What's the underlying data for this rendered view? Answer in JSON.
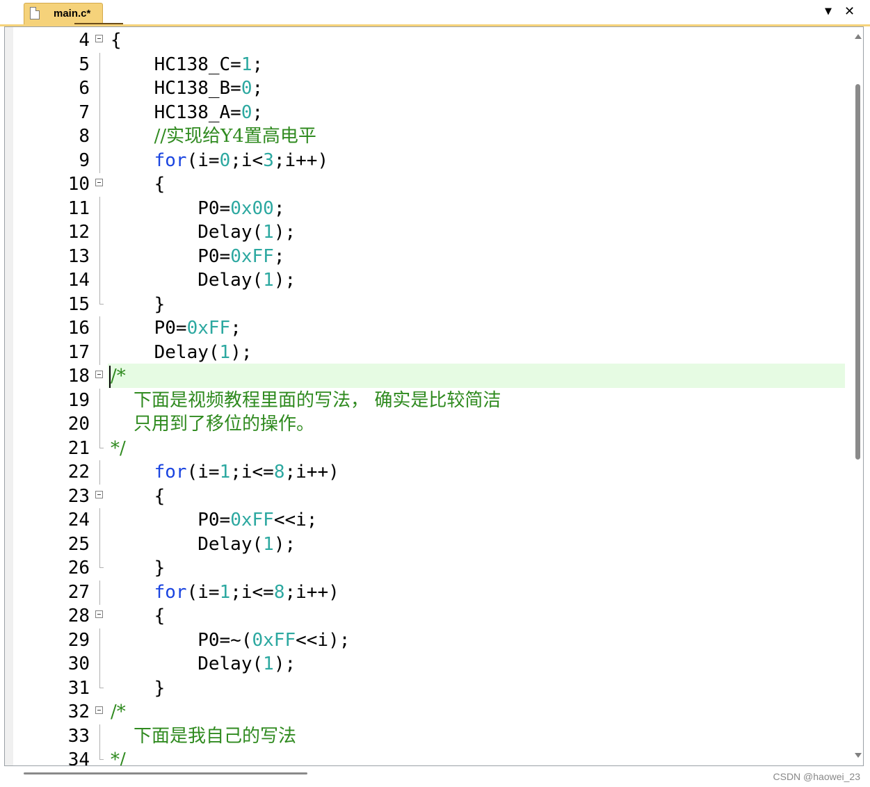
{
  "tab": {
    "filename": "main.c*"
  },
  "window_controls": {
    "dropdown_icon": "triangle-down",
    "close_label": "✕"
  },
  "colors": {
    "keyword": "#1a44e0",
    "number": "#2ca8a0",
    "comment": "#2f8a1f",
    "tab_bg": "#f5d27a",
    "highlight": "#e6fbe3"
  },
  "lines": [
    {
      "n": "4",
      "fold": "box",
      "code": "{"
    },
    {
      "n": "5",
      "fold": "line",
      "code": "    HC138_C=1;"
    },
    {
      "n": "6",
      "fold": "line",
      "code": "    HC138_B=0;"
    },
    {
      "n": "7",
      "fold": "line",
      "code": "    HC138_A=0;"
    },
    {
      "n": "8",
      "fold": "line",
      "code": "    //实现给Y4置高电平"
    },
    {
      "n": "9",
      "fold": "line",
      "code": "    for(i=0;i<3;i++)"
    },
    {
      "n": "10",
      "fold": "box",
      "code": "    {"
    },
    {
      "n": "11",
      "fold": "line",
      "code": "        P0=0x00;"
    },
    {
      "n": "12",
      "fold": "line",
      "code": "        Delay(1);"
    },
    {
      "n": "13",
      "fold": "line",
      "code": "        P0=0xFF;"
    },
    {
      "n": "14",
      "fold": "line",
      "code": "        Delay(1);"
    },
    {
      "n": "15",
      "fold": "end",
      "code": "    }"
    },
    {
      "n": "16",
      "fold": "line",
      "code": "    P0=0xFF;"
    },
    {
      "n": "17",
      "fold": "line",
      "code": "    Delay(1);"
    },
    {
      "n": "18",
      "fold": "box",
      "code": "/*"
    },
    {
      "n": "19",
      "fold": "line",
      "code": "    下面是视频教程里面的写法， 确实是比较简洁"
    },
    {
      "n": "20",
      "fold": "line",
      "code": "    只用到了移位的操作。"
    },
    {
      "n": "21",
      "fold": "end",
      "code": "*/"
    },
    {
      "n": "22",
      "fold": "line",
      "code": "    for(i=1;i<=8;i++)"
    },
    {
      "n": "23",
      "fold": "box",
      "code": "    {"
    },
    {
      "n": "24",
      "fold": "line",
      "code": "        P0=0xFF<<i;"
    },
    {
      "n": "25",
      "fold": "line",
      "code": "        Delay(1);"
    },
    {
      "n": "26",
      "fold": "end",
      "code": "    }"
    },
    {
      "n": "27",
      "fold": "line",
      "code": "    for(i=1;i<=8;i++)"
    },
    {
      "n": "28",
      "fold": "box",
      "code": "    {"
    },
    {
      "n": "29",
      "fold": "line",
      "code": "        P0=~(0xFF<<i);"
    },
    {
      "n": "30",
      "fold": "line",
      "code": "        Delay(1);"
    },
    {
      "n": "31",
      "fold": "end",
      "code": "    }"
    },
    {
      "n": "32",
      "fold": "box",
      "code": "/*"
    },
    {
      "n": "33",
      "fold": "line",
      "code": "    下面是我自己的写法"
    },
    {
      "n": "34",
      "fold": "end",
      "code": "*/"
    }
  ],
  "current_line": "18",
  "watermark": "CSDN @haowei_23"
}
